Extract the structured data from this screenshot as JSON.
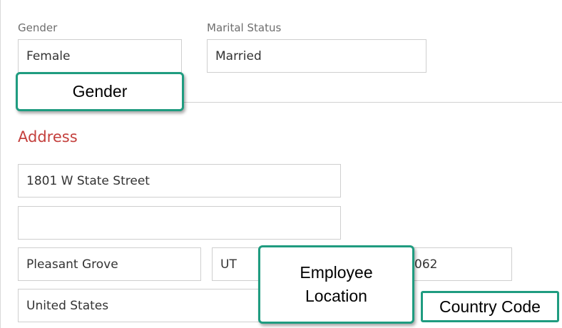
{
  "personal": {
    "gender": {
      "label": "Gender",
      "value": "Female"
    },
    "marital_status": {
      "label": "Marital Status",
      "value": "Married"
    }
  },
  "address": {
    "title": "Address",
    "line1": "1801 W State Street",
    "line2": "",
    "city": "Pleasant Grove",
    "state": "UT",
    "postal_code_visible": "062",
    "country": "United States"
  },
  "callouts": {
    "gender": "Gender",
    "employee_location_line1": "Employee",
    "employee_location_line2": "Location",
    "country_code": "Country Code"
  },
  "colors": {
    "section_title": "#c4403d",
    "callout_border": "#1f9c80",
    "field_border": "#cfcfcf",
    "label_text": "#6e6e6e"
  }
}
